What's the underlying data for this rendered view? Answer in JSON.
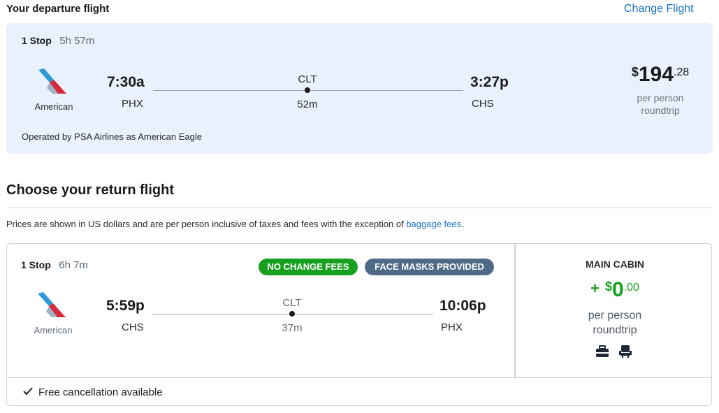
{
  "departure": {
    "header_title": "Your departure flight",
    "change_link": "Change Flight",
    "stops": "1 Stop",
    "duration": "5h 57m",
    "airline": "American",
    "depart_time": "7:30a",
    "depart_code": "PHX",
    "via_code": "CLT",
    "layover": "52m",
    "arrive_time": "3:27p",
    "arrive_code": "CHS",
    "price_symbol": "$",
    "price_whole": "194",
    "price_cents": ".28",
    "price_line1": "per person",
    "price_line2": "roundtrip",
    "operated_by": "Operated by PSA Airlines as American Eagle"
  },
  "return_section": {
    "title": "Choose your return flight",
    "notice_text": "Prices are shown in US dollars and are per person inclusive of taxes and fees with the exception of ",
    "notice_link": "baggage fees",
    "notice_end": "."
  },
  "return_flight": {
    "stops": "1 Stop",
    "duration": "6h 7m",
    "badge_1": "NO CHANGE FEES",
    "badge_2": "FACE MASKS PROVIDED",
    "airline": "American",
    "depart_time": "5:59p",
    "depart_code": "CHS",
    "via_code": "CLT",
    "layover": "37m",
    "arrive_time": "10:06p",
    "arrive_code": "PHX",
    "cabin": "MAIN CABIN",
    "price_plus": "+",
    "price_symbol": "$",
    "price_whole": "0",
    "price_cents": ".00",
    "price_line1": "per person",
    "price_line2": "roundtrip",
    "amenity_icons": [
      "luggage-icon",
      "seat-icon"
    ],
    "free_cancel": "Free cancellation available"
  },
  "colors": {
    "accent_blue": "#1a73c8",
    "card_bg": "#e8f1fc",
    "green": "#17a01f",
    "slate": "#4f6a87"
  }
}
